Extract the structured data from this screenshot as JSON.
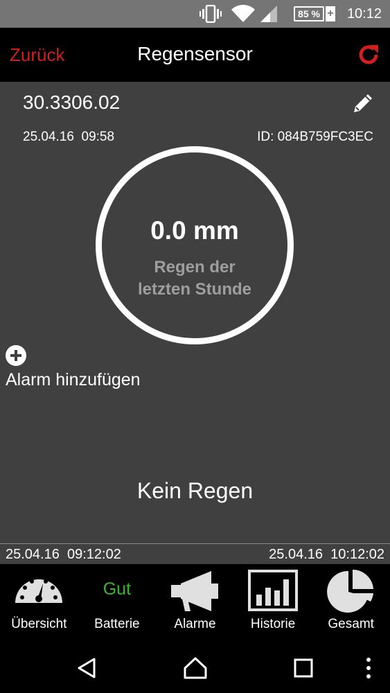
{
  "statusbar": {
    "battery": "85 %",
    "time": "10:12",
    "icons": [
      "vibrate-icon",
      "wifi-icon",
      "signal-icon",
      "battery-icon"
    ]
  },
  "header": {
    "back_label": "Zurück",
    "title": "Regensensor",
    "refresh_icon": "refresh-icon",
    "accent_color": "#d11f1f"
  },
  "sensor": {
    "name": "30.3306.02",
    "reading_time": "25.04.16  09:58",
    "id": "ID: 084B759FC3EC",
    "gauge_value": "0.0 mm",
    "gauge_label": "Regen der\nletzten Stunde"
  },
  "alarm": {
    "add_label": "Alarm hinzufügen"
  },
  "status": {
    "rain_text": "Kein Regen"
  },
  "range": {
    "start": "25.04.16  09:12:02",
    "end": "25.04.16  10:12:02"
  },
  "tabs": [
    {
      "label": "Übersicht",
      "icon": "speedometer-icon"
    },
    {
      "label": "Batterie",
      "value": "Gut",
      "value_color": "#3cb52e"
    },
    {
      "label": "Alarme",
      "icon": "megaphone-icon"
    },
    {
      "label": "Historie",
      "icon": "bar-chart-icon"
    },
    {
      "label": "Gesamt",
      "icon": "pie-chart-icon"
    }
  ],
  "navbar": {
    "icons": [
      "back-triangle-icon",
      "home-icon",
      "recents-icon",
      "more-icon"
    ]
  }
}
